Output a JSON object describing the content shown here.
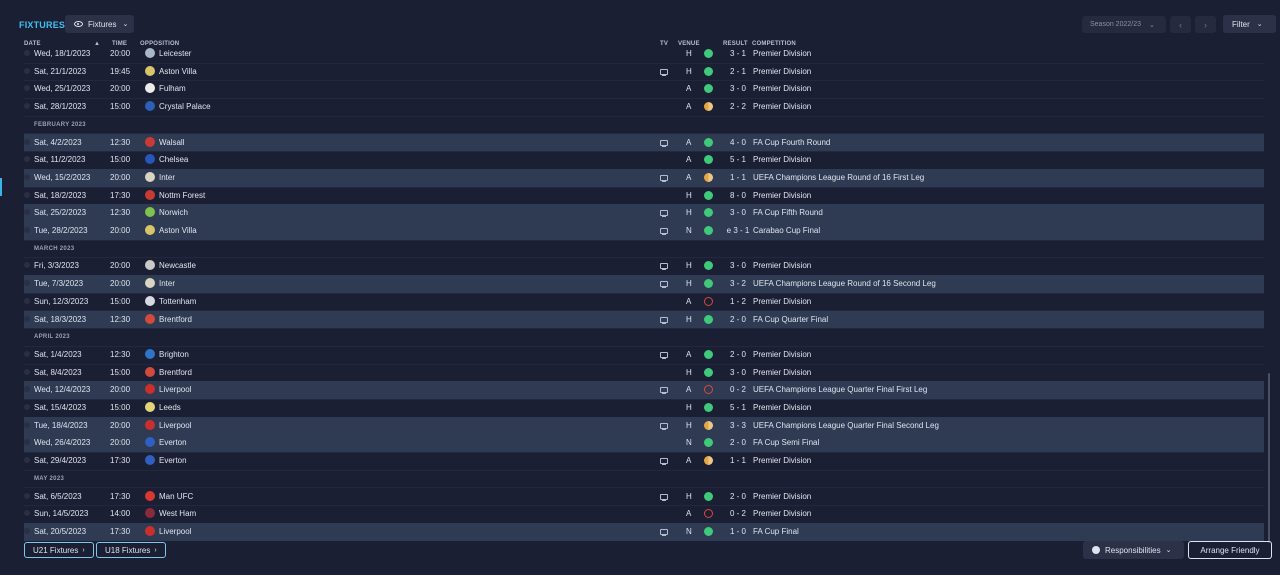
{
  "page": {
    "title": "FIXTURES",
    "view_label": "Fixtures",
    "season_label": "Season 2022/23",
    "filter_label": "Filter"
  },
  "columns": {
    "date": "DATE",
    "time": "TIME",
    "opposition": "OPPOSITION",
    "tv": "TV",
    "venue": "VENUE",
    "result": "RESULT",
    "competition": "COMPETITION"
  },
  "colors": {
    "accent": "#3ec0f0",
    "win": "#3fc97a",
    "draw": "#e8a640",
    "loss": "#e0453e",
    "highlight_row": "#2f3b52"
  },
  "fixtures": [
    {
      "type": "fixture",
      "date": "Wed, 18/1/2023",
      "time": "20:00",
      "badge_color": "#a8b7c9",
      "opposition": "Leicester",
      "tv": false,
      "venue": "H",
      "outcome": "win",
      "result": "3 - 1",
      "competition": "Premier Division",
      "hl": false
    },
    {
      "type": "fixture",
      "date": "Sat, 21/1/2023",
      "time": "19:45",
      "badge_color": "#d7c56a",
      "opposition": "Aston Villa",
      "tv": true,
      "venue": "H",
      "outcome": "win",
      "result": "2 - 1",
      "competition": "Premier Division",
      "hl": false
    },
    {
      "type": "fixture",
      "date": "Wed, 25/1/2023",
      "time": "20:00",
      "badge_color": "#ececec",
      "opposition": "Fulham",
      "tv": false,
      "venue": "A",
      "outcome": "win",
      "result": "3 - 0",
      "competition": "Premier Division",
      "hl": false
    },
    {
      "type": "fixture",
      "date": "Sat, 28/1/2023",
      "time": "15:00",
      "badge_color": "#2b5fb8",
      "opposition": "Crystal Palace",
      "tv": false,
      "venue": "A",
      "outcome": "draw",
      "result": "2 - 2",
      "competition": "Premier Division",
      "hl": false
    },
    {
      "type": "month",
      "label": "FEBRUARY 2023"
    },
    {
      "type": "fixture",
      "date": "Sat, 4/2/2023",
      "time": "12:30",
      "badge_color": "#c93a36",
      "opposition": "Walsall",
      "tv": true,
      "venue": "A",
      "outcome": "win",
      "result": "4 - 0",
      "competition": "FA Cup Fourth Round",
      "hl": true
    },
    {
      "type": "fixture",
      "date": "Sat, 11/2/2023",
      "time": "15:00",
      "badge_color": "#2656b7",
      "opposition": "Chelsea",
      "tv": false,
      "venue": "A",
      "outcome": "win",
      "result": "5 - 1",
      "competition": "Premier Division",
      "hl": false
    },
    {
      "type": "fixture",
      "date": "Wed, 15/2/2023",
      "time": "20:00",
      "badge_color": "#d8d6c2",
      "opposition": "Inter",
      "tv": true,
      "venue": "A",
      "outcome": "draw",
      "result": "1 - 1",
      "competition": "UEFA Champions League Round of 16  First Leg",
      "hl": true
    },
    {
      "type": "fixture",
      "date": "Sat, 18/2/2023",
      "time": "17:30",
      "badge_color": "#c83b35",
      "opposition": "Nottm Forest",
      "tv": false,
      "venue": "H",
      "outcome": "win",
      "result": "8 - 0",
      "competition": "Premier Division",
      "hl": false
    },
    {
      "type": "fixture",
      "date": "Sat, 25/2/2023",
      "time": "12:30",
      "badge_color": "#7fc24d",
      "opposition": "Norwich",
      "tv": true,
      "venue": "H",
      "outcome": "win",
      "result": "3 - 0",
      "competition": "FA Cup Fifth Round",
      "hl": true
    },
    {
      "type": "fixture",
      "date": "Tue, 28/2/2023",
      "time": "20:00",
      "badge_color": "#d7c56a",
      "opposition": "Aston Villa",
      "tv": true,
      "venue": "N",
      "outcome": "win",
      "result": "e 3 - 1",
      "competition": "Carabao Cup Final",
      "hl": true
    },
    {
      "type": "month",
      "label": "MARCH 2023"
    },
    {
      "type": "fixture",
      "date": "Fri, 3/3/2023",
      "time": "20:00",
      "badge_color": "#c9c9c9",
      "opposition": "Newcastle",
      "tv": true,
      "venue": "H",
      "outcome": "win",
      "result": "3 - 0",
      "competition": "Premier Division",
      "hl": false
    },
    {
      "type": "fixture",
      "date": "Tue, 7/3/2023",
      "time": "20:00",
      "badge_color": "#d8d6c2",
      "opposition": "Inter",
      "tv": true,
      "venue": "H",
      "outcome": "win",
      "result": "3 - 2",
      "competition": "UEFA Champions League Round of 16  Second Leg",
      "hl": true
    },
    {
      "type": "fixture",
      "date": "Sun, 12/3/2023",
      "time": "15:00",
      "badge_color": "#d6d9e3",
      "opposition": "Tottenham",
      "tv": false,
      "venue": "A",
      "outcome": "loss",
      "result": "1 - 2",
      "competition": "Premier Division",
      "hl": false
    },
    {
      "type": "fixture",
      "date": "Sat, 18/3/2023",
      "time": "12:30",
      "badge_color": "#d24a3c",
      "opposition": "Brentford",
      "tv": true,
      "venue": "H",
      "outcome": "win",
      "result": "2 - 0",
      "competition": "FA Cup Quarter Final",
      "hl": true
    },
    {
      "type": "month",
      "label": "APRIL 2023"
    },
    {
      "type": "fixture",
      "date": "Sat, 1/4/2023",
      "time": "12:30",
      "badge_color": "#2f74c9",
      "opposition": "Brighton",
      "tv": true,
      "venue": "A",
      "outcome": "win",
      "result": "2 - 0",
      "competition": "Premier Division",
      "hl": false
    },
    {
      "type": "fixture",
      "date": "Sat, 8/4/2023",
      "time": "15:00",
      "badge_color": "#d24a3c",
      "opposition": "Brentford",
      "tv": false,
      "venue": "H",
      "outcome": "win",
      "result": "3 - 0",
      "competition": "Premier Division",
      "hl": false
    },
    {
      "type": "fixture",
      "date": "Wed, 12/4/2023",
      "time": "20:00",
      "badge_color": "#c9302c",
      "opposition": "Liverpool",
      "tv": true,
      "venue": "A",
      "outcome": "loss",
      "result": "0 - 2",
      "competition": "UEFA Champions League Quarter Final First Leg",
      "hl": true
    },
    {
      "type": "fixture",
      "date": "Sat, 15/4/2023",
      "time": "15:00",
      "badge_color": "#e3d47a",
      "opposition": "Leeds",
      "tv": false,
      "venue": "H",
      "outcome": "win",
      "result": "5 - 1",
      "competition": "Premier Division",
      "hl": false
    },
    {
      "type": "fixture",
      "date": "Tue, 18/4/2023",
      "time": "20:00",
      "badge_color": "#c9302c",
      "opposition": "Liverpool",
      "tv": true,
      "venue": "H",
      "outcome": "draw",
      "result": "3 - 3",
      "competition": "UEFA Champions League Quarter Final Second Leg",
      "hl": true
    },
    {
      "type": "fixture",
      "date": "Wed, 26/4/2023",
      "time": "20:00",
      "badge_color": "#2f5fc0",
      "opposition": "Everton",
      "tv": false,
      "venue": "N",
      "outcome": "win",
      "result": "2 - 0",
      "competition": "FA Cup Semi Final",
      "hl": true
    },
    {
      "type": "fixture",
      "date": "Sat, 29/4/2023",
      "time": "17:30",
      "badge_color": "#2f5fc0",
      "opposition": "Everton",
      "tv": true,
      "venue": "A",
      "outcome": "draw",
      "result": "1 - 1",
      "competition": "Premier Division",
      "hl": false
    },
    {
      "type": "month",
      "label": "MAY 2023"
    },
    {
      "type": "fixture",
      "date": "Sat, 6/5/2023",
      "time": "17:30",
      "badge_color": "#d8382f",
      "opposition": "Man UFC",
      "tv": true,
      "venue": "H",
      "outcome": "win",
      "result": "2 - 0",
      "competition": "Premier Division",
      "hl": false
    },
    {
      "type": "fixture",
      "date": "Sun, 14/5/2023",
      "time": "14:00",
      "badge_color": "#8a2b3c",
      "opposition": "West Ham",
      "tv": false,
      "venue": "A",
      "outcome": "loss",
      "result": "0 - 2",
      "competition": "Premier Division",
      "hl": false
    },
    {
      "type": "fixture",
      "date": "Sat, 20/5/2023",
      "time": "17:30",
      "badge_color": "#c9302c",
      "opposition": "Liverpool",
      "tv": true,
      "venue": "N",
      "outcome": "win",
      "result": "1 - 0",
      "competition": "FA Cup Final",
      "hl": true
    }
  ],
  "footer": {
    "u21_label": "U21 Fixtures",
    "u18_label": "U18 Fixtures",
    "responsibilities_label": "Responsibilities",
    "arrange_label": "Arrange Friendly"
  }
}
